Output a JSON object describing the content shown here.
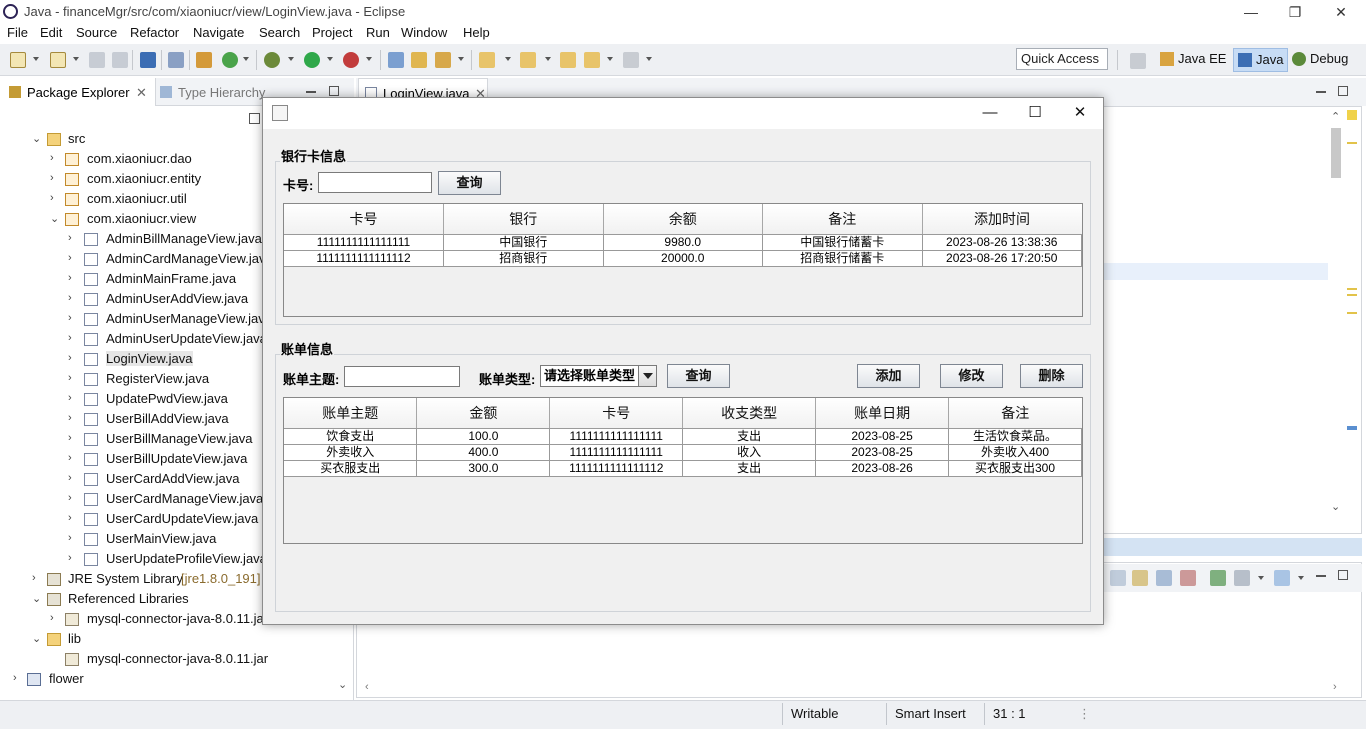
{
  "window": {
    "title": "Java - financeMgr/src/com/xiaoniucr/view/LoginView.java - Eclipse",
    "minimize": "—",
    "restore": "❐",
    "close": "✕"
  },
  "menu": [
    "File",
    "Edit",
    "Source",
    "Refactor",
    "Navigate",
    "Search",
    "Project",
    "Run",
    "Window",
    "Help"
  ],
  "toolbar": {
    "quick_access": "Quick Access",
    "perspectives": [
      "Java EE",
      "Java",
      "Debug"
    ]
  },
  "package_explorer": {
    "tab_label": "Package Explorer",
    "tab2_label": "Type Hierarchy",
    "tree": [
      {
        "label": "src",
        "depth": 1,
        "icon": "folder-icon",
        "arrow": "⌄"
      },
      {
        "label": "com.xiaoniucr.dao",
        "depth": 2,
        "icon": "package-icon",
        "arrow": "›"
      },
      {
        "label": "com.xiaoniucr.entity",
        "depth": 2,
        "icon": "package-icon",
        "arrow": "›"
      },
      {
        "label": "com.xiaoniucr.util",
        "depth": 2,
        "icon": "package-icon",
        "arrow": "›"
      },
      {
        "label": "com.xiaoniucr.view",
        "depth": 2,
        "icon": "package-icon",
        "arrow": "⌄"
      },
      {
        "label": "AdminBillManageView.java",
        "depth": 3,
        "icon": "java-file-icon",
        "arrow": "›"
      },
      {
        "label": "AdminCardManageView.java",
        "depth": 3,
        "icon": "java-file-icon",
        "arrow": "›"
      },
      {
        "label": "AdminMainFrame.java",
        "depth": 3,
        "icon": "java-file-icon",
        "arrow": "›"
      },
      {
        "label": "AdminUserAddView.java",
        "depth": 3,
        "icon": "java-file-icon",
        "arrow": "›"
      },
      {
        "label": "AdminUserManageView.java",
        "depth": 3,
        "icon": "java-file-icon",
        "arrow": "›"
      },
      {
        "label": "AdminUserUpdateView.java",
        "depth": 3,
        "icon": "java-file-icon",
        "arrow": "›"
      },
      {
        "label": "LoginView.java",
        "depth": 3,
        "icon": "java-file-icon",
        "arrow": "›",
        "selected": true
      },
      {
        "label": "RegisterView.java",
        "depth": 3,
        "icon": "java-file-icon",
        "arrow": "›"
      },
      {
        "label": "UpdatePwdView.java",
        "depth": 3,
        "icon": "java-file-icon",
        "arrow": "›"
      },
      {
        "label": "UserBillAddView.java",
        "depth": 3,
        "icon": "java-file-icon",
        "arrow": "›"
      },
      {
        "label": "UserBillManageView.java",
        "depth": 3,
        "icon": "java-file-icon",
        "arrow": "›"
      },
      {
        "label": "UserBillUpdateView.java",
        "depth": 3,
        "icon": "java-file-icon",
        "arrow": "›"
      },
      {
        "label": "UserCardAddView.java",
        "depth": 3,
        "icon": "java-file-icon",
        "arrow": "›"
      },
      {
        "label": "UserCardManageView.java",
        "depth": 3,
        "icon": "java-file-icon",
        "arrow": "›"
      },
      {
        "label": "UserCardUpdateView.java",
        "depth": 3,
        "icon": "java-file-icon",
        "arrow": "›"
      },
      {
        "label": "UserMainView.java",
        "depth": 3,
        "icon": "java-file-icon",
        "arrow": "›"
      },
      {
        "label": "UserUpdateProfileView.java",
        "depth": 3,
        "icon": "java-file-icon",
        "arrow": "›"
      },
      {
        "label": "JRE System Library",
        "suffix": " [jre1.8.0_191]",
        "depth": 1,
        "icon": "library-icon",
        "arrow": "›"
      },
      {
        "label": "Referenced Libraries",
        "depth": 1,
        "icon": "library-icon",
        "arrow": "⌄"
      },
      {
        "label": "mysql-connector-java-8.0.11.jar",
        "depth": 2,
        "icon": "jar-icon",
        "arrow": "›"
      },
      {
        "label": "lib",
        "depth": 1,
        "icon": "folder-icon",
        "arrow": "⌄"
      },
      {
        "label": "mysql-connector-java-8.0.11.jar",
        "depth": 2,
        "icon": "jar-icon",
        "arrow": ""
      },
      {
        "label": "flower",
        "depth": 0,
        "icon": "project-icon",
        "arrow": "›"
      }
    ]
  },
  "editor": {
    "tab_label": "LoginView.java"
  },
  "statusbar": {
    "writable": "Writable",
    "insert_mode": "Smart Insert",
    "position": "31 : 1"
  },
  "dialog": {
    "card_section": {
      "title": "银行卡信息",
      "card_no_label": "卡号:",
      "card_no_value": "",
      "query_button": "查询",
      "columns": [
        "卡号",
        "银行",
        "余额",
        "备注",
        "添加时间"
      ],
      "rows": [
        [
          "1111111111111111",
          "中国银行",
          "9980.0",
          "中国银行储蓄卡",
          "2023-08-26 13:38:36"
        ],
        [
          "1111111111111112",
          "招商银行",
          "20000.0",
          "招商银行储蓄卡",
          "2023-08-26 17:20:50"
        ]
      ]
    },
    "bill_section": {
      "title": "账单信息",
      "subject_label": "账单主题:",
      "subject_value": "",
      "type_label": "账单类型:",
      "type_selected": "请选择账单类型",
      "query_button": "查询",
      "add_button": "添加",
      "edit_button": "修改",
      "delete_button": "删除",
      "columns": [
        "账单主题",
        "金额",
        "卡号",
        "收支类型",
        "账单日期",
        "备注"
      ],
      "rows": [
        [
          "饮食支出",
          "100.0",
          "1111111111111111",
          "支出",
          "2023-08-25",
          "生活饮食菜品。"
        ],
        [
          "外卖收入",
          "400.0",
          "1111111111111111",
          "收入",
          "2023-08-25",
          "外卖收入400"
        ],
        [
          "买衣服支出",
          "300.0",
          "1111111111111112",
          "支出",
          "2023-08-26",
          "买衣服支出300"
        ]
      ]
    }
  }
}
